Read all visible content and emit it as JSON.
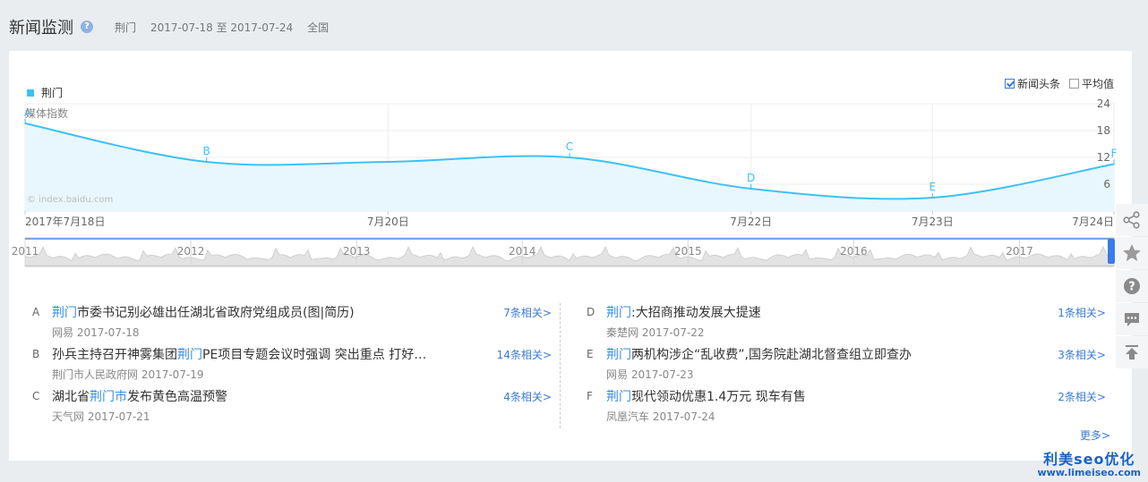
{
  "header": {
    "title": "新闻监测",
    "keyword": "荆门",
    "date_range": "2017-07-18 至 2017-07-24",
    "region": "全国"
  },
  "legend": {
    "label": "荆门",
    "color": "#3ec1f5"
  },
  "options": {
    "headline": {
      "label": "新闻头条",
      "checked": true
    },
    "average": {
      "label": "平均值",
      "checked": false
    }
  },
  "chart_data": {
    "type": "area",
    "ylabel": "媒体指数",
    "watermark": "© index.baidu.com",
    "yticks": [
      "24",
      "18",
      "12",
      "6"
    ],
    "ylim": [
      0,
      24
    ],
    "x": [
      "2017-07-18",
      "2017-07-19",
      "2017-07-20",
      "2017-07-21",
      "2017-07-22",
      "2017-07-23",
      "2017-07-24"
    ],
    "xtick_labels": [
      "2017年7月18日",
      "7月20日",
      "7月22日",
      "7月23日",
      "7月24日"
    ],
    "xtick_dates": [
      "2017-07-18",
      "2017-07-20",
      "2017-07-22",
      "2017-07-23",
      "2017-07-24"
    ],
    "series": [
      {
        "name": "荆门",
        "values": [
          19.6,
          11.0,
          11.0,
          12.0,
          5.0,
          3.0,
          10.5
        ]
      }
    ],
    "markers": [
      {
        "letter": "A",
        "x": "2017-07-18"
      },
      {
        "letter": "B",
        "x": "2017-07-19"
      },
      {
        "letter": "C",
        "x": "2017-07-21"
      },
      {
        "letter": "D",
        "x": "2017-07-22"
      },
      {
        "letter": "E",
        "x": "2017-07-23"
      },
      {
        "letter": "F",
        "x": "2017-07-24"
      }
    ],
    "navigator_years": [
      "2011",
      "2012",
      "2013",
      "2014",
      "2015",
      "2016",
      "2017"
    ],
    "color": "#3ec1f5",
    "fill": "#e8f7fd",
    "grid": true
  },
  "news": {
    "left": [
      {
        "letter": "A",
        "pre": "",
        "kw": "荆门",
        "post": "市委书记别必雄出任湖北省政府党组成员(图|简历)",
        "source": "网易 2017-07-18",
        "related": "7条相关>"
      },
      {
        "letter": "B",
        "pre": "孙兵主持召开神雾集团",
        "kw": "荆门",
        "post": "PE项目专题会议时强调 突出重点 打好…",
        "source": "荆门市人民政府网 2017-07-19",
        "related": "14条相关>"
      },
      {
        "letter": "C",
        "pre": "湖北省",
        "kw": "荆门市",
        "post": "发布黄色高温预警",
        "source": "天气网 2017-07-21",
        "related": "4条相关>"
      }
    ],
    "right": [
      {
        "letter": "D",
        "pre": "",
        "kw": "荆门",
        "post": ":大招商推动发展大提速",
        "source": "秦楚网 2017-07-22",
        "related": "1条相关>"
      },
      {
        "letter": "E",
        "pre": "",
        "kw": "荆门",
        "post": "两机构涉企“乱收费”,国务院赴湖北督查组立即查办",
        "source": "网易 2017-07-23",
        "related": "3条相关>"
      },
      {
        "letter": "F",
        "pre": "",
        "kw": "荆门",
        "post": "现代领动优惠1.4万元 现车有售",
        "source": "凤凰汽车 2017-07-24",
        "related": "2条相关>"
      }
    ],
    "more": "更多>"
  },
  "toolbar": [
    "share-icon",
    "star-icon",
    "help-icon",
    "comment-icon",
    "top-icon"
  ],
  "watermark_brand": {
    "line1": "利美seo优化",
    "line2": "www.limeiseo.com"
  }
}
